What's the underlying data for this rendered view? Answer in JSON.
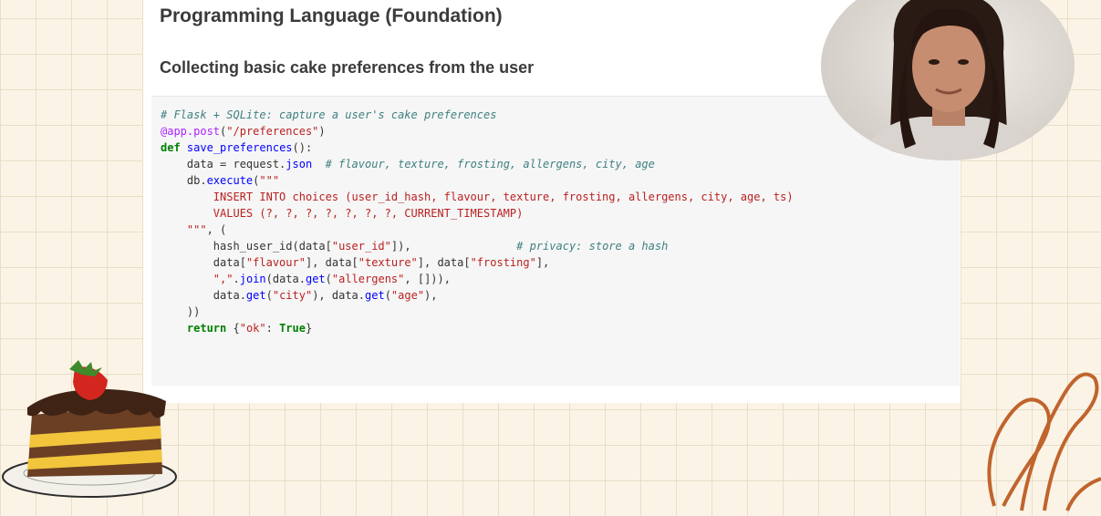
{
  "slide": {
    "title": "Programming Language (Foundation)",
    "subtitle": "Collecting basic cake preferences from the user"
  },
  "code": {
    "lines": [
      [
        [
          "cm",
          "# Flask + SQLite: capture a user's cake preferences"
        ]
      ],
      [
        [
          "dec",
          "@app.post"
        ],
        [
          "nm",
          "("
        ],
        [
          "st",
          "\"/preferences\""
        ],
        [
          "nm",
          ")"
        ]
      ],
      [
        [
          "kw",
          "def"
        ],
        [
          "nm",
          " "
        ],
        [
          "fn",
          "save_preferences"
        ],
        [
          "nm",
          "():"
        ]
      ],
      [
        [
          "nm",
          "    data = request."
        ],
        [
          "fn",
          "json"
        ],
        [
          "nm",
          "  "
        ],
        [
          "cm",
          "# flavour, texture, frosting, allergens, city, age"
        ]
      ],
      [
        [
          "nm",
          "    db."
        ],
        [
          "fn",
          "execute"
        ],
        [
          "nm",
          "("
        ],
        [
          "st",
          "\"\"\""
        ]
      ],
      [
        [
          "st",
          "        INSERT INTO choices (user_id_hash, flavour, texture, frosting, allergens, city, age, ts)"
        ]
      ],
      [
        [
          "st",
          "        VALUES (?, ?, ?, ?, ?, ?, ?, CURRENT_TIMESTAMP)"
        ]
      ],
      [
        [
          "st",
          "    \"\"\""
        ],
        [
          "nm",
          ", ("
        ]
      ],
      [
        [
          "nm",
          "        hash_user_id(data["
        ],
        [
          "st",
          "\"user_id\""
        ],
        [
          "nm",
          "]),                "
        ],
        [
          "cm",
          "# privacy: store a hash"
        ]
      ],
      [
        [
          "nm",
          "        data["
        ],
        [
          "st",
          "\"flavour\""
        ],
        [
          "nm",
          "], data["
        ],
        [
          "st",
          "\"texture\""
        ],
        [
          "nm",
          "], data["
        ],
        [
          "st",
          "\"frosting\""
        ],
        [
          "nm",
          "],"
        ]
      ],
      [
        [
          "nm",
          "        "
        ],
        [
          "st",
          "\",\""
        ],
        [
          "nm",
          "."
        ],
        [
          "fn",
          "join"
        ],
        [
          "nm",
          "(data."
        ],
        [
          "fn",
          "get"
        ],
        [
          "nm",
          "("
        ],
        [
          "st",
          "\"allergens\""
        ],
        [
          "nm",
          ", [])),"
        ]
      ],
      [
        [
          "nm",
          "        data."
        ],
        [
          "fn",
          "get"
        ],
        [
          "nm",
          "("
        ],
        [
          "st",
          "\"city\""
        ],
        [
          "nm",
          "), data."
        ],
        [
          "fn",
          "get"
        ],
        [
          "nm",
          "("
        ],
        [
          "st",
          "\"age\""
        ],
        [
          "nm",
          "),"
        ]
      ],
      [
        [
          "nm",
          "    ))"
        ]
      ],
      [
        [
          "nm",
          "    "
        ],
        [
          "kw",
          "return"
        ],
        [
          "nm",
          " {"
        ],
        [
          "st",
          "\"ok\""
        ],
        [
          "nm",
          ": "
        ],
        [
          "kw",
          "True"
        ],
        [
          "nm",
          "}"
        ]
      ]
    ]
  },
  "colors": {
    "background": "#fbf4e6",
    "comment": "#408080",
    "decorator": "#aa22ff",
    "keyword": "#008000",
    "function": "#0000ff",
    "string": "#ba2121"
  },
  "icons": [
    "webcam-presenter",
    "cake-slice-illustration",
    "swirl-decoration"
  ]
}
